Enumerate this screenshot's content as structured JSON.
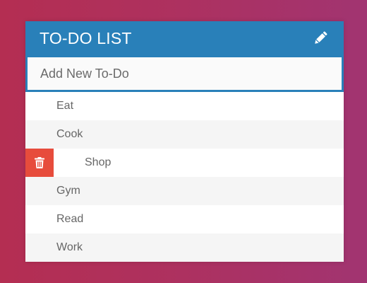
{
  "header": {
    "title": "TO-DO LIST",
    "edit_icon": "pencil-icon",
    "color": "#2980b9"
  },
  "input": {
    "placeholder": "Add New To-Do",
    "value": ""
  },
  "todos": [
    {
      "label": "Eat",
      "hovered": false
    },
    {
      "label": "Cook",
      "hovered": false
    },
    {
      "label": "Shop",
      "hovered": true,
      "delete_icon": "trash-icon"
    },
    {
      "label": "Gym",
      "hovered": false
    },
    {
      "label": "Read",
      "hovered": false
    },
    {
      "label": "Work",
      "hovered": false
    }
  ],
  "colors": {
    "accent": "#2980b9",
    "delete": "#e74c3c",
    "text": "#666666",
    "row_alt": "#f5f5f5"
  }
}
